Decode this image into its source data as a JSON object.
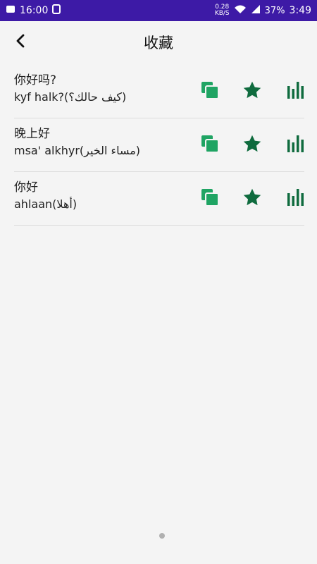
{
  "status_bar": {
    "time": "16:00",
    "net_speed_value": "0.28",
    "net_speed_unit": "KB/S",
    "battery_text": "37%",
    "clock_right": "3:49"
  },
  "header": {
    "title": "收藏"
  },
  "favorites": [
    {
      "chinese": "你好吗?",
      "transliteration": "kyf halk?(كيف حالك؟)"
    },
    {
      "chinese": "晚上好",
      "transliteration": "msa' alkhyr(مساء الخير)"
    },
    {
      "chinese": "你好",
      "transliteration": "ahlaan(أهلا)"
    }
  ],
  "colors": {
    "status_bar": "#3d1aa6",
    "copy_green": "#1fa463",
    "star_green": "#0f6b3e",
    "bars_green": "#0f6b3e"
  },
  "icons": {
    "back": "arrow-back-icon",
    "copy": "copy-icon",
    "star": "star-icon",
    "audio": "audio-bars-icon"
  }
}
